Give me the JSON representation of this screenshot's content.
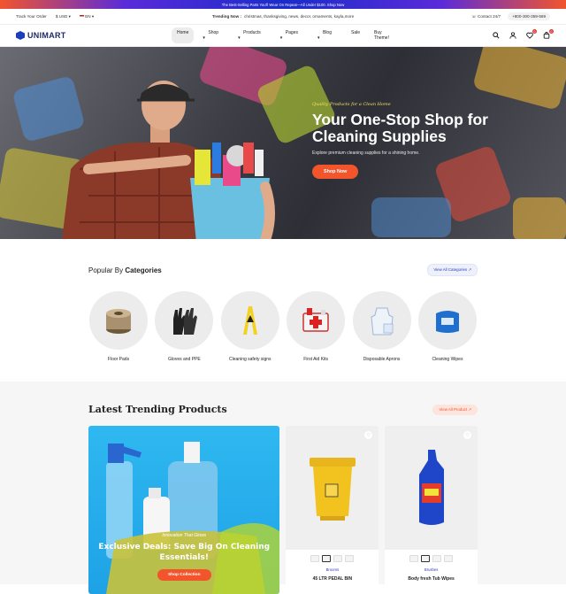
{
  "topbar": {
    "text": "The Best-Selling Parts You'll Wear On Repeat—All Under $100. Shop Now"
  },
  "utility": {
    "track": "Track Your Order",
    "currency": "$ USD",
    "language": "EN",
    "trending_label": "Trending Now :",
    "trending_items": "christmas, thanksgiving, news, decor, ornaments, kayla,more",
    "contact": "Contact 24/7",
    "phone": "+800-300-359-569"
  },
  "nav": {
    "logo": "UNIMART",
    "menu": [
      "Home",
      "Shop",
      "Products",
      "Pages",
      "Blog",
      "Sale",
      "Buy Theme!"
    ],
    "wishlist_count": "0",
    "cart_count": "0"
  },
  "hero": {
    "kicker": "Quality Products for a Clean Home",
    "title": "Your One-Stop Shop for Cleaning Supplies",
    "subtitle": "Explore premium cleaning supplies for a shining home.",
    "button": "Shop Now"
  },
  "categories": {
    "title_prefix": "Popular By",
    "title_bold": "Categories",
    "view_all": "View All Categories",
    "items": [
      {
        "label": "Floor Pads",
        "icon": "floor-pad-icon"
      },
      {
        "label": "Gloves and PPE",
        "icon": "gloves-icon"
      },
      {
        "label": "Cleaning safety signs",
        "icon": "caution-sign-icon"
      },
      {
        "label": "First Aid Kits",
        "icon": "first-aid-kit-icon"
      },
      {
        "label": "Disposable Aprons",
        "icon": "apron-icon"
      },
      {
        "label": "Cleaning Wipes",
        "icon": "wipes-pack-icon"
      }
    ]
  },
  "trending": {
    "title": "Latest Trending Products",
    "view_all": "View All Product",
    "promo": {
      "kicker": "Innovation That Glows",
      "title": "Exclusive Deals: Save Big On Cleaning Essentials!",
      "button": "Shop Collection"
    },
    "products": [
      {
        "category": "Brooms",
        "name": "45 LTR PEDAL BIN"
      },
      {
        "category": "Brushes",
        "name": "Body fresh Tub Wipes"
      }
    ]
  },
  "colors": {
    "accent": "#f2552c",
    "brand": "#1b3fb8",
    "hero_kicker": "#f2e25a"
  }
}
